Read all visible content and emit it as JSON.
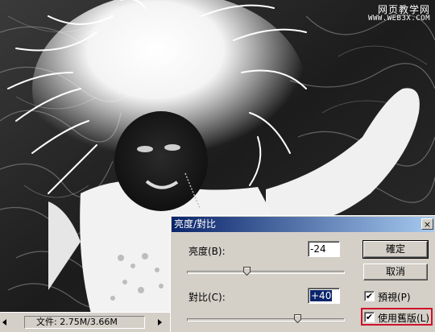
{
  "watermark": {
    "line1": "网页教学网",
    "line2": "WWW.WEB3X.COM"
  },
  "status_bar": {
    "doc_info": "文件: 2.75M/3.66M"
  },
  "dialog": {
    "title": "亮度/對比",
    "close_label": "×",
    "brightness": {
      "label": "亮度(B):",
      "value": "-24",
      "level": -24
    },
    "contrast": {
      "label": "對比(C):",
      "value": "+40",
      "level": 40
    },
    "ok_label": "確定",
    "cancel_label": "取消",
    "preview": {
      "label": "預視(P)",
      "checked": true,
      "mark": "✔"
    },
    "legacy": {
      "label": "使用舊版(L)",
      "checked": true,
      "mark": "✔"
    }
  },
  "colors": {
    "title_start": "#0a246a",
    "title_end": "#a6caf0",
    "highlight": "#d0102a",
    "dialog_bg": "#d4d0c8"
  }
}
